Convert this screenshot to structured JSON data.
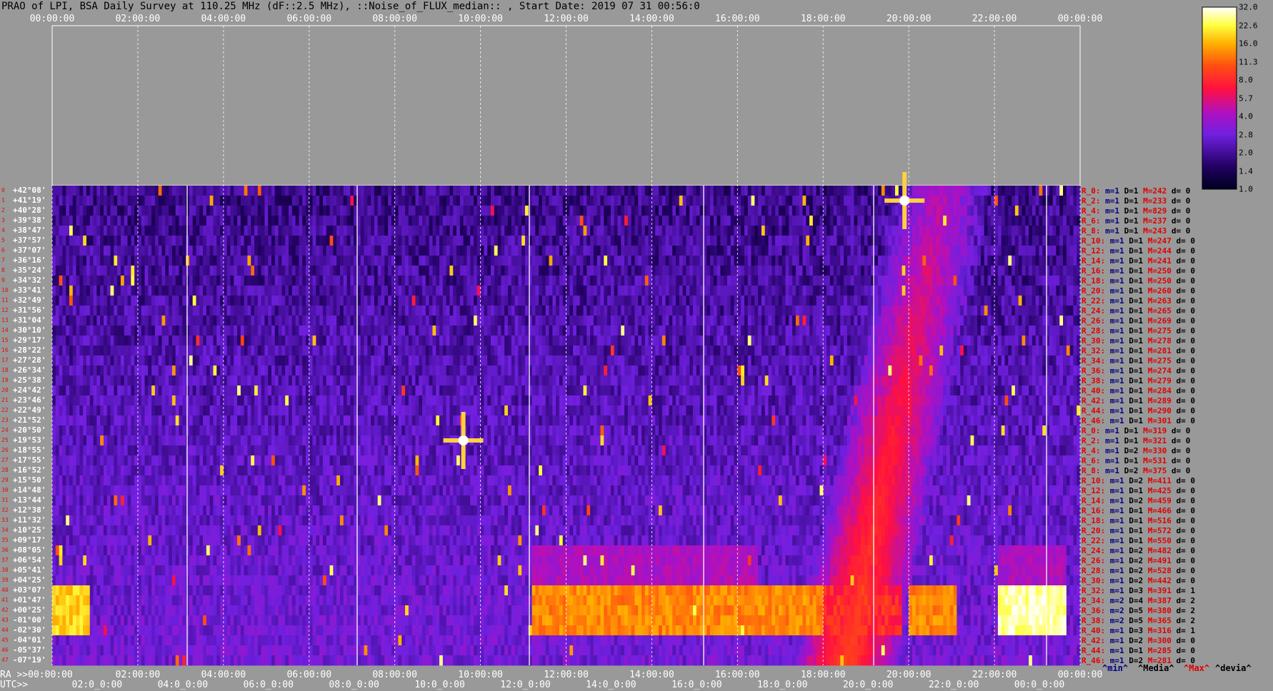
{
  "title": "PRAO of LPI, BSA Daily Survey at 110.25 MHz (dF::2.5 MHz), ::Noise_of_FLUX_median:: , Start Date: 2019 07 31 00:56:0",
  "top_ticks": [
    "00:00:00",
    "02:00:00",
    "04:00:00",
    "06:00:00",
    "08:00:00",
    "10:00:00",
    "12:00:00",
    "14:00:00",
    "16:00:00",
    "18:00:00",
    "20:00:00",
    "22:00:00",
    "00:00:00"
  ],
  "ra_label": "RA >>00:00:00",
  "bottom_ra_ticks": [
    "02:00:00",
    "04:00:00",
    "06:00:00",
    "08:00:00",
    "10:00:00",
    "12:00:00",
    "14:00:00",
    "16:00:00",
    "18:00:00",
    "20:00:00",
    "22:00:00",
    "00:00:00"
  ],
  "utc_label": "UTC>>",
  "bottom_utc_ticks": [
    "02:0_0:00",
    "04:0_0:00",
    "06:0_0:00",
    "08:0_0:00",
    "10:0_0:00",
    "12:0_0:00",
    "14:0_0:00",
    "16:0_0:00",
    "18:0_0:00",
    "20:0_0:00",
    "22:0_0:00",
    "00:0_0:00"
  ],
  "declinations": [
    "+42°08'",
    "+41°19'",
    "+40°28'",
    "+39°38'",
    "+38°47'",
    "+37°57'",
    "+37°07'",
    "+36°16'",
    "+35°24'",
    "+34°32'",
    "+33°41'",
    "+32°49'",
    "+31°56'",
    "+31°04'",
    "+30°10'",
    "+29°17'",
    "+28°22'",
    "+27°28'",
    "+26°34'",
    "+25°38'",
    "+24°42'",
    "+23°46'",
    "+22°49'",
    "+21°52'",
    "+20°50'",
    "+19°53'",
    "+18°55'",
    "+17°55'",
    "+16°52'",
    "+15°50'",
    "+14°48'",
    "+13°44'",
    "+12°38'",
    "+11°32'",
    "+10°25'",
    "+09°17'",
    "+08°05'",
    "+06°54'",
    "+05°41'",
    "+04°25'",
    "+03°07'",
    "+01°47'",
    "+00°25'",
    "-01°00'",
    "-02°30'",
    "-04°01'",
    "-05°37'",
    "-07°19'"
  ],
  "row_numbers": [
    "0",
    "1",
    "2",
    "3",
    "4",
    "5",
    "6",
    "7",
    "8",
    "9",
    "10",
    "11",
    "12",
    "13",
    "14",
    "15",
    "16",
    "17",
    "18",
    "19",
    "20",
    "21",
    "22",
    "23",
    "24",
    "25",
    "26",
    "27",
    "28",
    "29",
    "30",
    "31",
    "32",
    "33",
    "34",
    "35",
    "36",
    "37",
    "38",
    "39",
    "40",
    "41",
    "42",
    "43",
    "44",
    "45",
    "46",
    "47"
  ],
  "row_stats": [
    {
      "r": "R_0:",
      "m": "m=1",
      "d": "D=1",
      "mx": "M=242",
      "dv": "d= 0"
    },
    {
      "r": "R_2:",
      "m": "m=1",
      "d": "D=1",
      "mx": "M=233",
      "dv": "d= 0"
    },
    {
      "r": "R_4:",
      "m": "m=1",
      "d": "D=1",
      "mx": "M=829",
      "dv": "d= 0"
    },
    {
      "r": "R_6:",
      "m": "m=1",
      "d": "D=1",
      "mx": "M=237",
      "dv": "d= 0"
    },
    {
      "r": "R_8:",
      "m": "m=1",
      "d": "D=1",
      "mx": "M=243",
      "dv": "d= 0"
    },
    {
      "r": "R_10:",
      "m": "m=1",
      "d": "D=1",
      "mx": "M=247",
      "dv": "d= 0"
    },
    {
      "r": "R_12:",
      "m": "m=1",
      "d": "D=1",
      "mx": "M=244",
      "dv": "d= 0"
    },
    {
      "r": "R_14:",
      "m": "m=1",
      "d": "D=1",
      "mx": "M=241",
      "dv": "d= 0"
    },
    {
      "r": "R_16:",
      "m": "m=1",
      "d": "D=1",
      "mx": "M=250",
      "dv": "d= 0"
    },
    {
      "r": "R_18:",
      "m": "m=1",
      "d": "D=1",
      "mx": "M=250",
      "dv": "d= 0"
    },
    {
      "r": "R_20:",
      "m": "m=1",
      "d": "D=1",
      "mx": "M=260",
      "dv": "d= 0"
    },
    {
      "r": "R_22:",
      "m": "m=1",
      "d": "D=1",
      "mx": "M=263",
      "dv": "d= 0"
    },
    {
      "r": "R_24:",
      "m": "m=1",
      "d": "D=1",
      "mx": "M=265",
      "dv": "d= 0"
    },
    {
      "r": "R_26:",
      "m": "m=1",
      "d": "D=1",
      "mx": "M=269",
      "dv": "d= 0"
    },
    {
      "r": "R_28:",
      "m": "m=1",
      "d": "D=1",
      "mx": "M=275",
      "dv": "d= 0"
    },
    {
      "r": "R_30:",
      "m": "m=1",
      "d": "D=1",
      "mx": "M=278",
      "dv": "d= 0"
    },
    {
      "r": "R_32:",
      "m": "m=1",
      "d": "D=1",
      "mx": "M=281",
      "dv": "d= 0"
    },
    {
      "r": "R_34:",
      "m": "m=1",
      "d": "D=1",
      "mx": "M=275",
      "dv": "d= 0"
    },
    {
      "r": "R_36:",
      "m": "m=1",
      "d": "D=1",
      "mx": "M=274",
      "dv": "d= 0"
    },
    {
      "r": "R_38:",
      "m": "m=1",
      "d": "D=1",
      "mx": "M=279",
      "dv": "d= 0"
    },
    {
      "r": "R_40:",
      "m": "m=1",
      "d": "D=1",
      "mx": "M=284",
      "dv": "d= 0"
    },
    {
      "r": "R_42:",
      "m": "m=1",
      "d": "D=1",
      "mx": "M=289",
      "dv": "d= 0"
    },
    {
      "r": "R_44:",
      "m": "m=1",
      "d": "D=1",
      "mx": "M=290",
      "dv": "d= 0"
    },
    {
      "r": "R_46:",
      "m": "m=1",
      "d": "D=1",
      "mx": "M=301",
      "dv": "d= 0"
    },
    {
      "r": "R_0:",
      "m": "m=1",
      "d": "D=1",
      "mx": "M=319",
      "dv": "d= 0"
    },
    {
      "r": "R_2:",
      "m": "m=1",
      "d": "D=1",
      "mx": "M=321",
      "dv": "d= 0"
    },
    {
      "r": "R_4:",
      "m": "m=1",
      "d": "D=2",
      "mx": "M=330",
      "dv": "d= 0"
    },
    {
      "r": "R_6:",
      "m": "m=1",
      "d": "D=1",
      "mx": "M=531",
      "dv": "d= 0"
    },
    {
      "r": "R_8:",
      "m": "m=1",
      "d": "D=2",
      "mx": "M=375",
      "dv": "d= 0"
    },
    {
      "r": "R_10:",
      "m": "m=1",
      "d": "D=2",
      "mx": "M=411",
      "dv": "d= 0"
    },
    {
      "r": "R_12:",
      "m": "m=1",
      "d": "D=1",
      "mx": "M=425",
      "dv": "d= 0"
    },
    {
      "r": "R_14:",
      "m": "m=1",
      "d": "D=2",
      "mx": "M=459",
      "dv": "d= 0"
    },
    {
      "r": "R_16:",
      "m": "m=1",
      "d": "D=1",
      "mx": "M=466",
      "dv": "d= 0"
    },
    {
      "r": "R_18:",
      "m": "m=1",
      "d": "D=1",
      "mx": "M=516",
      "dv": "d= 0"
    },
    {
      "r": "R_20:",
      "m": "m=1",
      "d": "D=1",
      "mx": "M=572",
      "dv": "d= 0"
    },
    {
      "r": "R_22:",
      "m": "m=1",
      "d": "D=1",
      "mx": "M=550",
      "dv": "d= 0"
    },
    {
      "r": "R_24:",
      "m": "m=1",
      "d": "D=2",
      "mx": "M=482",
      "dv": "d= 0"
    },
    {
      "r": "R_26:",
      "m": "m=1",
      "d": "D=2",
      "mx": "M=491",
      "dv": "d= 0"
    },
    {
      "r": "R_28:",
      "m": "m=1",
      "d": "D=2",
      "mx": "M=528",
      "dv": "d= 0"
    },
    {
      "r": "R_30:",
      "m": "m=1",
      "d": "D=2",
      "mx": "M=442",
      "dv": "d= 0"
    },
    {
      "r": "R_32:",
      "m": "m=1",
      "d": "D=3",
      "mx": "M=391",
      "dv": "d= 1"
    },
    {
      "r": "R_34:",
      "m": "m=2",
      "d": "D=4",
      "mx": "M=387",
      "dv": "d= 2"
    },
    {
      "r": "R_36:",
      "m": "m=2",
      "d": "D=5",
      "mx": "M=380",
      "dv": "d= 2"
    },
    {
      "r": "R_38:",
      "m": "m=2",
      "d": "D=5",
      "mx": "M=365",
      "dv": "d= 2"
    },
    {
      "r": "R_40:",
      "m": "m=1",
      "d": "D=3",
      "mx": "M=316",
      "dv": "d= 1"
    },
    {
      "r": "R_42:",
      "m": "m=1",
      "d": "D=2",
      "mx": "M=300",
      "dv": "d= 0"
    },
    {
      "r": "R_44:",
      "m": "m=1",
      "d": "D=1",
      "mx": "M=285",
      "dv": "d= 0"
    },
    {
      "r": "R_46:",
      "m": "m=1",
      "d": "D=2",
      "mx": "M=281",
      "dv": "d= 0"
    }
  ],
  "legend": {
    "min": "^min^",
    "median": "^Media^",
    "max": "^Max^",
    "dev": "^devia^"
  },
  "colorbar_labels": [
    "32.0",
    "22.6",
    "16.0",
    "11.3",
    "8.0",
    "5.7",
    "4.0",
    "2.8",
    "2.0",
    "1.4",
    "1.0"
  ],
  "colors": {
    "background": "#999999",
    "low": "#0a0020",
    "mid": "#8020ff",
    "high": "#ff2010",
    "max": "#ffffe0"
  },
  "chart_data": {
    "type": "heatmap",
    "title": "PRAO of LPI, BSA Daily Survey at 110.25 MHz (dF::2.5 MHz), ::Noise_of_FLUX_median:: , Start Date: 2019 07 31 00:56:0",
    "x_axis": "RA / UTC (hours)",
    "xlim_ra_hours": [
      0,
      24
    ],
    "rows": 48,
    "colorbar_range": [
      1.0,
      32.0
    ],
    "colorbar_scale": "log2",
    "features": [
      {
        "kind": "point_source",
        "ra_hours": 9.6,
        "dec": "+19°",
        "intensity": 32
      },
      {
        "kind": "point_source",
        "ra_hours": 19.9,
        "dec": "+41°",
        "intensity": 32
      },
      {
        "kind": "bright_band",
        "ra_hours": [
          0.0,
          0.85
        ],
        "dec": [
          "+03°",
          "-03°"
        ],
        "intensity": 22
      },
      {
        "kind": "bright_band",
        "ra_hours": [
          11.2,
          18.0
        ],
        "dec": [
          "+03°",
          "-03°"
        ],
        "intensity": 16
      },
      {
        "kind": "bright_band",
        "ra_hours": [
          22.1,
          23.7
        ],
        "dec": [
          "+03°",
          "-03°"
        ],
        "intensity": 32
      },
      {
        "kind": "bright_band",
        "ra_hours": [
          20.0,
          21.1
        ],
        "dec": [
          "+03°",
          "-03°"
        ],
        "intensity": 16
      },
      {
        "kind": "milky_way_arc",
        "ra_hours": [
          18.5,
          20.8
        ],
        "dec": [
          "-07°",
          "+42°"
        ],
        "intensity": 5
      }
    ]
  }
}
